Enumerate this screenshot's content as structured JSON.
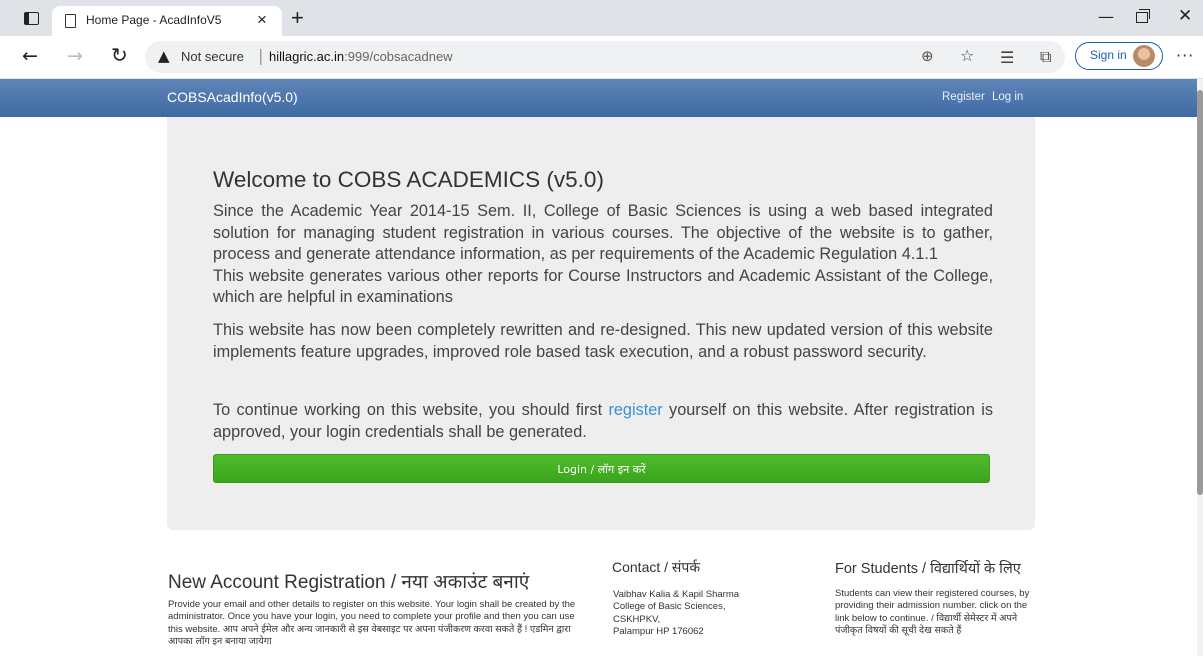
{
  "browser": {
    "tab_title": "Home Page - AcadInfoV5",
    "tab_close": "×",
    "new_tab": "+",
    "security_label": "Not secure",
    "url_host": "hillagric.ac.in",
    "url_rest": ":999/cobsacadnew",
    "sign_in_label": "Sign in"
  },
  "navbar": {
    "brand": "COBSAcadInfo(v5.0)",
    "register": "Register",
    "login": "Log in"
  },
  "jumbotron": {
    "title": "Welcome to COBS ACADEMICS (v5.0)",
    "paragraph1": "Since the Academic Year 2014-15 Sem. II, College of Basic Sciences is using a web based integrated solution for managing student registration in various courses. The objective of the website is to gather, process and generate attendance information, as per requirements of the Academic Regulation 4.1.1",
    "paragraph1b": "This website generates various other reports for Course Instructors and Academic Assistant of the College, which are helpful in examinations",
    "paragraph2": "This website has now been completely rewritten and re-designed. This new updated version of this website implements feature upgrades, improved role based task execution, and a robust password security.",
    "paragraph3_before": "To continue working on this website, you should first ",
    "paragraph3_link": "register",
    "paragraph3_after": " yourself on this website. After registration is approved, your login credentials shall be generated.",
    "login_button": "Login / लॉग इन करें"
  },
  "footer": {
    "registration": {
      "title": "New Account Registration / नया अकाउंट बनाएं",
      "text": "Provide your email and other details to register on this website. Your login shall be created by the administrator. Once you have your login, you need to complete your profile and then you can use this website. आप अपने ईमेल और अन्य जानकारी से इस वेबसाइट पर अपना पंजीकरण करवा सकते हैं ! एडमिन द्वारा आपका लॉग इन बनाया जायेगा"
    },
    "contact": {
      "title": "Contact / संपर्क",
      "lines": [
        "Vaibhav Kalia & Kapil Sharma",
        "College of Basic Sciences,",
        "CSKHPKV,",
        "Palampur HP 176062"
      ]
    },
    "students": {
      "title": "For Students / विद्यार्थियों के लिए",
      "text": "Students can view their registered courses, by providing their admission number. click on the link below to continue. / विद्यार्थी सेमेस्टर में अपने पंजीकृत विषयों की सूची देख सकते हैं"
    }
  }
}
